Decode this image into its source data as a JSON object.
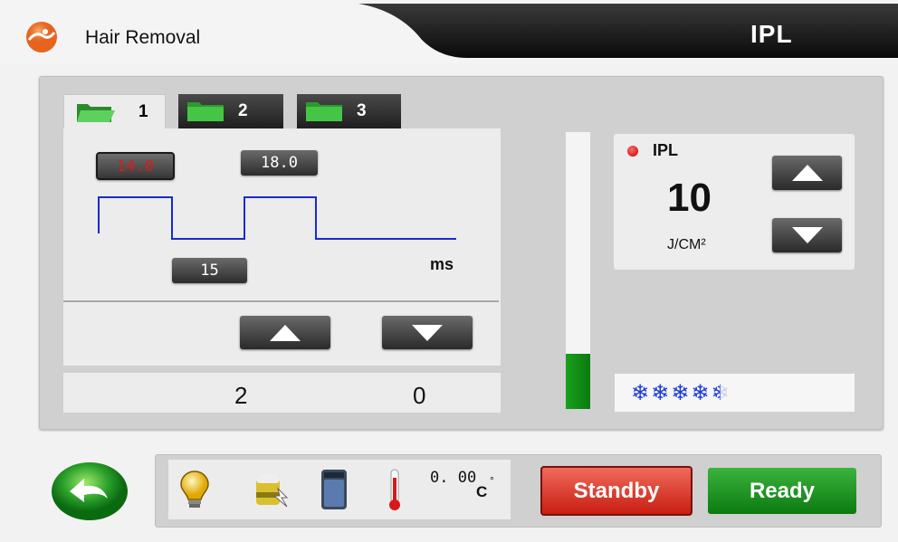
{
  "header": {
    "app_title": "Hair Removal",
    "mode_title": "IPL",
    "icons": {
      "logo": "runner-logo-icon"
    }
  },
  "tabs": [
    {
      "label": "1",
      "icon": "folder-open-icon",
      "active": true
    },
    {
      "label": "2",
      "icon": "folder-icon",
      "active": false
    },
    {
      "label": "3",
      "icon": "folder-icon",
      "active": false
    }
  ],
  "pulse": {
    "pulse1_value": "14.0",
    "pulse2_value": "18.0",
    "delay_value": "15",
    "unit": "ms"
  },
  "counters": {
    "left": "2",
    "right": "0"
  },
  "energy": {
    "mode_label": "IPL",
    "value": "10",
    "unit": "J/CM²",
    "gauge_level": 0.2
  },
  "cooling": {
    "level": 4.5,
    "max": 5,
    "icon": "snowflake-icon"
  },
  "status": {
    "icons": [
      "lamp-icon",
      "battery-icon",
      "water-tank-icon",
      "thermometer-icon"
    ],
    "temperature": "0. 00",
    "temperature_unit": "C",
    "degree_symbol": "°",
    "standby_label": "Standby",
    "ready_label": "Ready"
  },
  "colors": {
    "accent_red": "#e01818",
    "standby_red": "#d2261a",
    "ready_green": "#109014",
    "waveform_blue": "#1a2ad0",
    "snowflake_blue": "#1a3ad8"
  }
}
